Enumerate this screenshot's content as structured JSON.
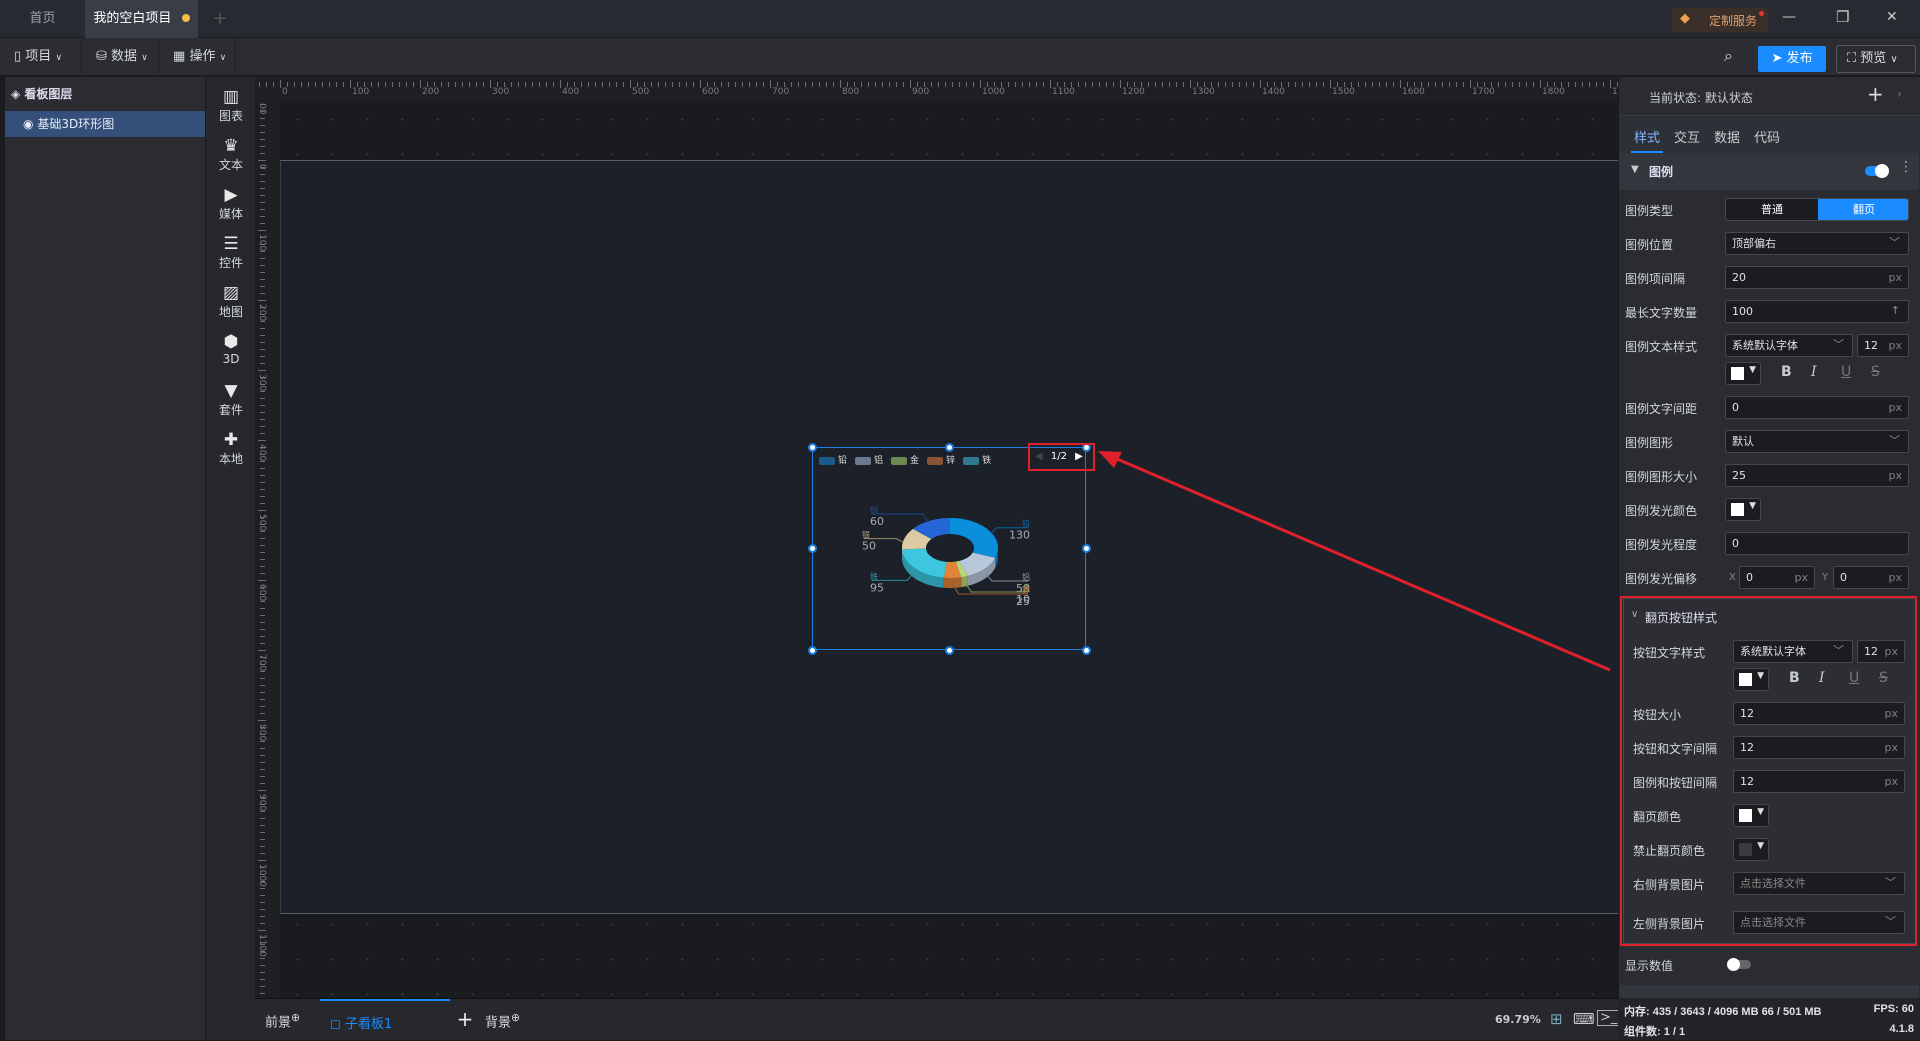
{
  "tabs": [
    {
      "label": "首页"
    },
    {
      "label": "我的空白项目",
      "modified": true
    }
  ],
  "window": {
    "service_label": "定制服务",
    "minimize": "—",
    "restore": "❐",
    "close": "✕"
  },
  "toolbar": {
    "project": "项目",
    "data": "数据",
    "operate": "操作",
    "publish": "发布",
    "preview": "预览"
  },
  "layers": {
    "title": "看板图层",
    "items": [
      {
        "label": "基础3D环形图",
        "selected": true
      }
    ]
  },
  "components": [
    {
      "icon": "bar-chart-icon",
      "glyph": "▥",
      "label": "图表"
    },
    {
      "icon": "crown-icon",
      "glyph": "♛",
      "label": "文本"
    },
    {
      "icon": "camera-icon",
      "glyph": "▶",
      "label": "媒体"
    },
    {
      "icon": "list-icon",
      "glyph": "☰",
      "label": "控件"
    },
    {
      "icon": "map-icon",
      "glyph": "▨",
      "label": "地图"
    },
    {
      "icon": "cube-icon",
      "glyph": "⬢",
      "label": "3D"
    },
    {
      "icon": "shirt-icon",
      "glyph": "▼",
      "label": "套件"
    },
    {
      "icon": "puzzle-icon",
      "glyph": "✚",
      "label": "本地"
    }
  ],
  "ruler": {
    "x_labels": [
      0,
      100,
      200,
      300,
      400,
      500,
      600,
      700,
      800,
      900,
      1000,
      1100,
      1200,
      1300,
      1400,
      1500,
      1600,
      1700,
      1800,
      1900
    ],
    "y_labels": [
      -100,
      0,
      100,
      200,
      300,
      400,
      500,
      600,
      700,
      800,
      900,
      1000,
      1100,
      1200
    ]
  },
  "chart_data": {
    "type": "pie",
    "variant": "3d-donut",
    "legend": [
      "铅",
      "铝",
      "金",
      "锌",
      "铁"
    ],
    "legend_page": "1/2",
    "legend_colors": [
      "#1d5a8c",
      "#6b7890",
      "#6a8a50",
      "#8a5236",
      "#2f7890"
    ],
    "slices": [
      {
        "name": "铅",
        "value": 130,
        "color": "#0a8fdc"
      },
      {
        "name": "铝",
        "value": 58,
        "color": "#b8c8da"
      },
      {
        "name": "金",
        "value": 10,
        "color": "#b8d878"
      },
      {
        "name": "锌",
        "value": 25,
        "color": "#e0843a"
      },
      {
        "name": "铁",
        "value": 95,
        "color": "#3cc6e0"
      },
      {
        "name": "银",
        "value": 50,
        "color": "#dccaa2"
      },
      {
        "name": "铜",
        "value": 60,
        "color": "#2466d4"
      }
    ]
  },
  "bottom": {
    "foreground": "前景",
    "board": "子看板1",
    "add": "+",
    "background": "背景",
    "zoom": "69.79%"
  },
  "panel": {
    "state_label": "当前状态: 默认状态",
    "add": "+",
    "tabs": [
      "样式",
      "交互",
      "数据",
      "代码"
    ],
    "active_tab": "样式",
    "section": "图例",
    "section_enabled": true,
    "legend_type": {
      "label": "图例类型",
      "options": [
        "普通",
        "翻页"
      ],
      "selected": "翻页"
    },
    "legend_position": {
      "label": "图例位置",
      "value": "顶部偏右"
    },
    "legend_gap": {
      "label": "图例项间隔",
      "value": "20",
      "unit": "px"
    },
    "max_chars": {
      "label": "最长文字数量",
      "value": "100"
    },
    "text_style": {
      "label": "图例文本样式",
      "font": "系统默认字体",
      "size": "12",
      "unit": "px",
      "color": "#ffffff"
    },
    "text_spacing": {
      "label": "图例文字间距",
      "value": "0",
      "unit": "px"
    },
    "shape": {
      "label": "图例图形",
      "value": "默认"
    },
    "shape_size": {
      "label": "图例图形大小",
      "value": "25",
      "unit": "px"
    },
    "glow_color": {
      "label": "图例发光颜色",
      "color": "#ffffff"
    },
    "glow_level": {
      "label": "图例发光程度",
      "value": "0"
    },
    "glow_offset": {
      "label": "图例发光偏移",
      "x": "0",
      "y": "0",
      "unit": "px"
    },
    "pager": {
      "title": "翻页按钮样式",
      "text_style": {
        "label": "按钮文字样式",
        "font": "系统默认字体",
        "size": "12",
        "unit": "px",
        "color": "#ffffff"
      },
      "button_size": {
        "label": "按钮大小",
        "value": "12",
        "unit": "px"
      },
      "button_text_gap": {
        "label": "按钮和文字间隔",
        "value": "12",
        "unit": "px"
      },
      "legend_button_gap": {
        "label": "图例和按钮间隔",
        "value": "12",
        "unit": "px"
      },
      "page_color": {
        "label": "翻页颜色",
        "color": "#ffffff"
      },
      "disabled_color": {
        "label": "禁止翻页颜色",
        "color": "#3a3b3e"
      },
      "right_image": {
        "label": "右侧背景图片",
        "placeholder": "点击选择文件"
      },
      "left_image": {
        "label": "左侧背景图片",
        "placeholder": "点击选择文件"
      }
    },
    "show_value": {
      "label": "显示数值",
      "enabled": false
    }
  },
  "status": {
    "memory": "内存: 435 / 3643 / 4096 MB  66 / 501 MB",
    "fps": "FPS: 60",
    "count": "组件数: 1 / 1",
    "version": "4.1.8"
  },
  "colors": {
    "accent": "#1a8cff",
    "annotation": "#e0202a"
  }
}
